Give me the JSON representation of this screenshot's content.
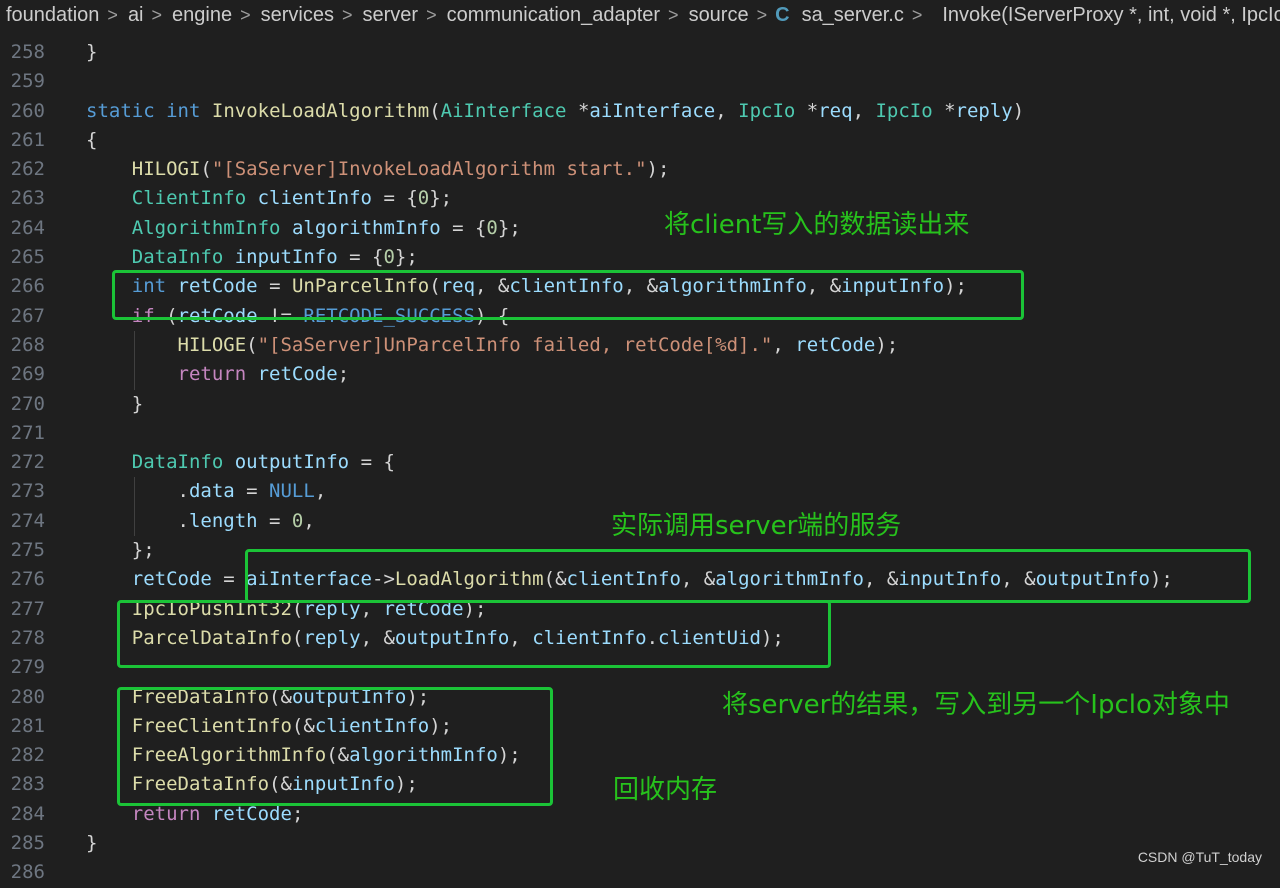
{
  "breadcrumb": {
    "segments": [
      "foundation",
      "ai",
      "engine",
      "services",
      "server",
      "communication_adapter",
      "source"
    ],
    "file_icon_glyph": "C",
    "file_name": "sa_server.c",
    "symbol_icon": "cube-icon",
    "symbol": "Invoke(IServerProxy *, int, void *, IpcIo"
  },
  "lines": [
    {
      "n": "258",
      "t": [
        [
          "pl",
          "}"
        ]
      ]
    },
    {
      "n": "259",
      "t": []
    },
    {
      "n": "260",
      "t": [
        [
          "kw",
          "static"
        ],
        [
          "pl",
          " "
        ],
        [
          "kw",
          "int"
        ],
        [
          "pl",
          " "
        ],
        [
          "fn",
          "InvokeLoadAlgorithm"
        ],
        [
          "pl",
          "("
        ],
        [
          "ty",
          "AiInterface"
        ],
        [
          "pl",
          " *"
        ],
        [
          "var",
          "aiInterface"
        ],
        [
          "pl",
          ", "
        ],
        [
          "ty",
          "IpcIo"
        ],
        [
          "pl",
          " *"
        ],
        [
          "var",
          "req"
        ],
        [
          "pl",
          ", "
        ],
        [
          "ty",
          "IpcIo"
        ],
        [
          "pl",
          " *"
        ],
        [
          "var",
          "reply"
        ],
        [
          "pl",
          ")"
        ]
      ]
    },
    {
      "n": "261",
      "t": [
        [
          "pl",
          "{"
        ]
      ]
    },
    {
      "n": "262",
      "t": [
        [
          "pl",
          "    "
        ],
        [
          "fn",
          "HILOGI"
        ],
        [
          "pl",
          "("
        ],
        [
          "str",
          "\"[SaServer]InvokeLoadAlgorithm start.\""
        ],
        [
          "pl",
          ");"
        ]
      ]
    },
    {
      "n": "263",
      "t": [
        [
          "pl",
          "    "
        ],
        [
          "ty",
          "ClientInfo"
        ],
        [
          "pl",
          " "
        ],
        [
          "var",
          "clientInfo"
        ],
        [
          "pl",
          " = {"
        ],
        [
          "num",
          "0"
        ],
        [
          "pl",
          "};"
        ]
      ]
    },
    {
      "n": "264",
      "t": [
        [
          "pl",
          "    "
        ],
        [
          "ty",
          "AlgorithmInfo"
        ],
        [
          "pl",
          " "
        ],
        [
          "var",
          "algorithmInfo"
        ],
        [
          "pl",
          " = {"
        ],
        [
          "num",
          "0"
        ],
        [
          "pl",
          "};"
        ]
      ]
    },
    {
      "n": "265",
      "t": [
        [
          "pl",
          "    "
        ],
        [
          "ty",
          "DataInfo"
        ],
        [
          "pl",
          " "
        ],
        [
          "var",
          "inputInfo"
        ],
        [
          "pl",
          " = {"
        ],
        [
          "num",
          "0"
        ],
        [
          "pl",
          "};"
        ]
      ]
    },
    {
      "n": "266",
      "t": [
        [
          "pl",
          "    "
        ],
        [
          "kw",
          "int"
        ],
        [
          "pl",
          " "
        ],
        [
          "var",
          "retCode"
        ],
        [
          "pl",
          " = "
        ],
        [
          "fn",
          "UnParcelInfo"
        ],
        [
          "pl",
          "("
        ],
        [
          "var",
          "req"
        ],
        [
          "pl",
          ", &"
        ],
        [
          "var",
          "clientInfo"
        ],
        [
          "pl",
          ", &"
        ],
        [
          "var",
          "algorithmInfo"
        ],
        [
          "pl",
          ", &"
        ],
        [
          "var",
          "inputInfo"
        ],
        [
          "pl",
          ");"
        ]
      ]
    },
    {
      "n": "267",
      "t": [
        [
          "pl",
          "    "
        ],
        [
          "ctl",
          "if"
        ],
        [
          "pl",
          " ("
        ],
        [
          "var",
          "retCode"
        ],
        [
          "pl",
          " != "
        ],
        [
          "kw",
          "RETCODE_SUCCESS"
        ],
        [
          "pl",
          ") {"
        ]
      ]
    },
    {
      "n": "268",
      "t": [
        [
          "pl",
          "        "
        ],
        [
          "fn",
          "HILOGE"
        ],
        [
          "pl",
          "("
        ],
        [
          "str",
          "\"[SaServer]UnParcelInfo failed, retCode[%d].\""
        ],
        [
          "pl",
          ", "
        ],
        [
          "var",
          "retCode"
        ],
        [
          "pl",
          ");"
        ]
      ]
    },
    {
      "n": "269",
      "t": [
        [
          "pl",
          "        "
        ],
        [
          "ctl",
          "return"
        ],
        [
          "pl",
          " "
        ],
        [
          "var",
          "retCode"
        ],
        [
          "pl",
          ";"
        ]
      ]
    },
    {
      "n": "270",
      "t": [
        [
          "pl",
          "    }"
        ]
      ]
    },
    {
      "n": "271",
      "t": []
    },
    {
      "n": "272",
      "t": [
        [
          "pl",
          "    "
        ],
        [
          "ty",
          "DataInfo"
        ],
        [
          "pl",
          " "
        ],
        [
          "var",
          "outputInfo"
        ],
        [
          "pl",
          " = {"
        ]
      ]
    },
    {
      "n": "273",
      "t": [
        [
          "pl",
          "        ."
        ],
        [
          "var",
          "data"
        ],
        [
          "pl",
          " = "
        ],
        [
          "kw",
          "NULL"
        ],
        [
          "pl",
          ","
        ]
      ]
    },
    {
      "n": "274",
      "t": [
        [
          "pl",
          "        ."
        ],
        [
          "var",
          "length"
        ],
        [
          "pl",
          " = "
        ],
        [
          "num",
          "0"
        ],
        [
          "pl",
          ","
        ]
      ]
    },
    {
      "n": "275",
      "t": [
        [
          "pl",
          "    };"
        ]
      ]
    },
    {
      "n": "276",
      "t": [
        [
          "pl",
          "    "
        ],
        [
          "var",
          "retCode"
        ],
        [
          "pl",
          " = "
        ],
        [
          "var",
          "aiInterface"
        ],
        [
          "pl",
          "->"
        ],
        [
          "fn",
          "LoadAlgorithm"
        ],
        [
          "pl",
          "(&"
        ],
        [
          "var",
          "clientInfo"
        ],
        [
          "pl",
          ", &"
        ],
        [
          "var",
          "algorithmInfo"
        ],
        [
          "pl",
          ", &"
        ],
        [
          "var",
          "inputInfo"
        ],
        [
          "pl",
          ", &"
        ],
        [
          "var",
          "outputInfo"
        ],
        [
          "pl",
          ");"
        ]
      ]
    },
    {
      "n": "277",
      "t": [
        [
          "pl",
          "    "
        ],
        [
          "fn",
          "IpcIoPushInt32"
        ],
        [
          "pl",
          "("
        ],
        [
          "var",
          "reply"
        ],
        [
          "pl",
          ", "
        ],
        [
          "var",
          "retCode"
        ],
        [
          "pl",
          ");"
        ]
      ]
    },
    {
      "n": "278",
      "t": [
        [
          "pl",
          "    "
        ],
        [
          "fn",
          "ParcelDataInfo"
        ],
        [
          "pl",
          "("
        ],
        [
          "var",
          "reply"
        ],
        [
          "pl",
          ", &"
        ],
        [
          "var",
          "outputInfo"
        ],
        [
          "pl",
          ", "
        ],
        [
          "var",
          "clientInfo"
        ],
        [
          "pl",
          "."
        ],
        [
          "var",
          "clientUid"
        ],
        [
          "pl",
          ");"
        ]
      ]
    },
    {
      "n": "279",
      "t": []
    },
    {
      "n": "280",
      "t": [
        [
          "pl",
          "    "
        ],
        [
          "fn",
          "FreeDataInfo"
        ],
        [
          "pl",
          "(&"
        ],
        [
          "var",
          "outputInfo"
        ],
        [
          "pl",
          ");"
        ]
      ]
    },
    {
      "n": "281",
      "t": [
        [
          "pl",
          "    "
        ],
        [
          "fn",
          "FreeClientInfo"
        ],
        [
          "pl",
          "(&"
        ],
        [
          "var",
          "clientInfo"
        ],
        [
          "pl",
          ");"
        ]
      ]
    },
    {
      "n": "282",
      "t": [
        [
          "pl",
          "    "
        ],
        [
          "fn",
          "FreeAlgorithmInfo"
        ],
        [
          "pl",
          "(&"
        ],
        [
          "var",
          "algorithmInfo"
        ],
        [
          "pl",
          ");"
        ]
      ]
    },
    {
      "n": "283",
      "t": [
        [
          "pl",
          "    "
        ],
        [
          "fn",
          "FreeDataInfo"
        ],
        [
          "pl",
          "(&"
        ],
        [
          "var",
          "inputInfo"
        ],
        [
          "pl",
          ");"
        ]
      ]
    },
    {
      "n": "284",
      "t": [
        [
          "pl",
          "    "
        ],
        [
          "ctl",
          "return"
        ],
        [
          "pl",
          " "
        ],
        [
          "var",
          "retCode"
        ],
        [
          "pl",
          ";"
        ]
      ]
    },
    {
      "n": "285",
      "t": [
        [
          "pl",
          "}"
        ]
      ]
    },
    {
      "n": "286",
      "t": []
    }
  ],
  "annotations": {
    "read_client_data": "将client写入的数据读出来",
    "call_server_service": "实际调用server端的服务",
    "write_result": "将server的结果，写入到另一个Ipclo对象中",
    "free_memory": "回收内存"
  },
  "watermark": "CSDN @TuT_today",
  "colors": {
    "background": "#1f1f1f",
    "highlight_box": "#1bc337",
    "annotation_text": "#27c21c"
  }
}
